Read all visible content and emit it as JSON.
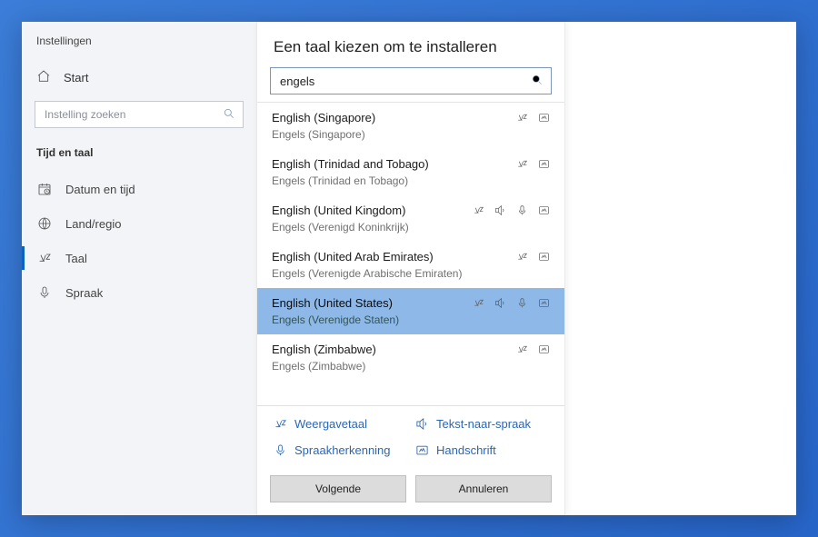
{
  "window": {
    "app_title": "Instellingen"
  },
  "sidebar": {
    "home": "Start",
    "search_placeholder": "Instelling zoeken",
    "section": "Tijd en taal",
    "items": [
      {
        "icon": "calendar-clock-icon",
        "label": "Datum en tijd"
      },
      {
        "icon": "globe-icon",
        "label": "Land/regio"
      },
      {
        "icon": "language-a-icon",
        "label": "Taal"
      },
      {
        "icon": "microphone-icon",
        "label": "Spraak"
      }
    ],
    "active_index": 2
  },
  "dialog": {
    "title": "Een taal kiezen om te installeren",
    "query": "engels",
    "languages": [
      {
        "name": "English (Singapore)",
        "local": "Engels (Singapore)",
        "caps": [
          "display",
          "hand"
        ]
      },
      {
        "name": "English (Trinidad and Tobago)",
        "local": "Engels (Trinidad en Tobago)",
        "caps": [
          "display",
          "hand"
        ]
      },
      {
        "name": "English (United Kingdom)",
        "local": "Engels (Verenigd Koninkrijk)",
        "caps": [
          "display",
          "tts",
          "voice",
          "hand"
        ]
      },
      {
        "name": "English (United Arab Emirates)",
        "local": "Engels (Verenigde Arabische Emiraten)",
        "caps": [
          "display",
          "hand"
        ]
      },
      {
        "name": "English (United States)",
        "local": "Engels (Verenigde Staten)",
        "caps": [
          "display",
          "tts",
          "voice",
          "hand"
        ],
        "selected": true
      },
      {
        "name": "English (Zimbabwe)",
        "local": "Engels (Zimbabwe)",
        "caps": [
          "display",
          "hand"
        ]
      }
    ],
    "legend": {
      "display": "Weergavetaal",
      "tts": "Tekst-naar-spraak",
      "voice": "Spraakherkenning",
      "hand": "Handschrift"
    },
    "buttons": {
      "next": "Volgende",
      "cancel": "Annuleren"
    }
  }
}
